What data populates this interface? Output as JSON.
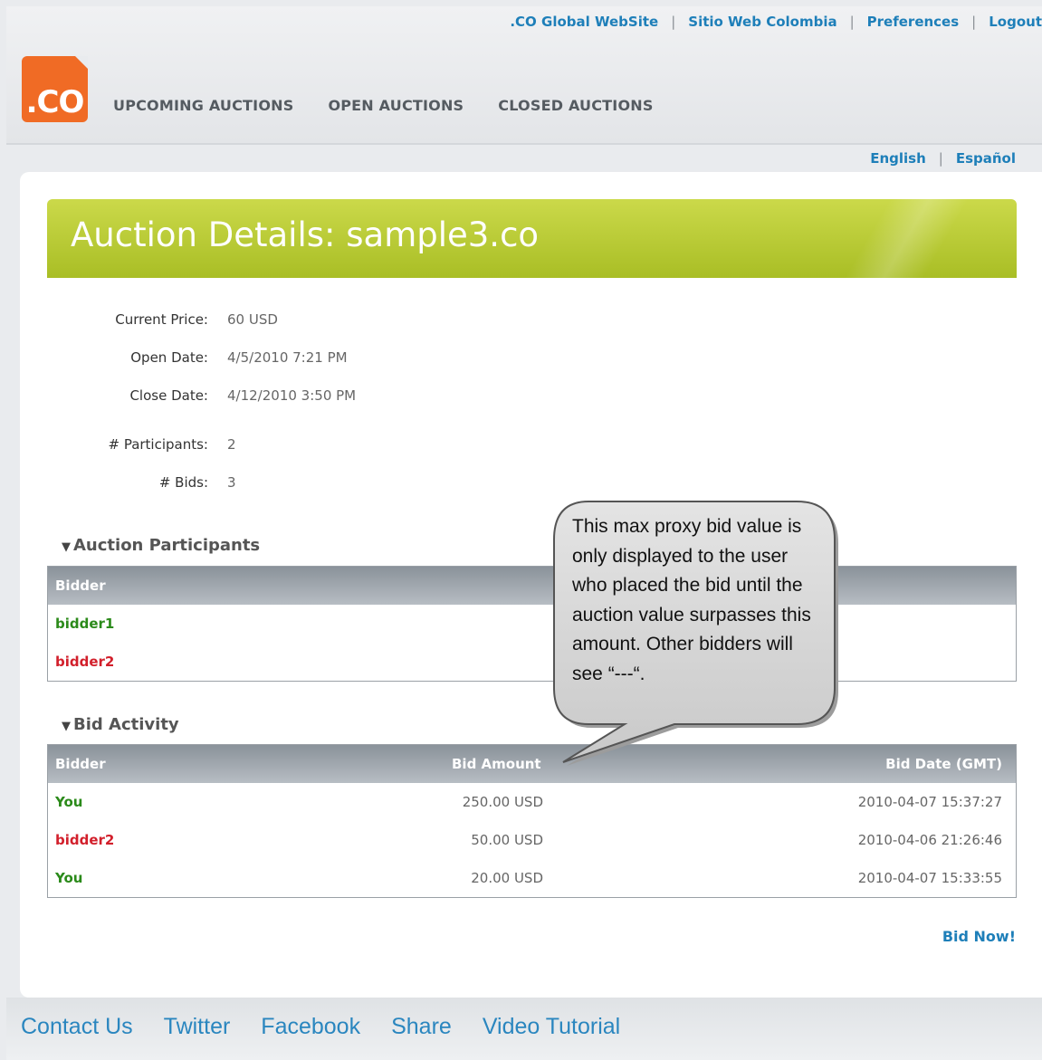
{
  "top_links": [
    ".CO Global WebSite",
    "Sitio Web Colombia",
    "Preferences",
    "Logout"
  ],
  "logo_text": ".CO",
  "main_nav": [
    "UPCOMING AUCTIONS",
    "OPEN AUCTIONS",
    "CLOSED AUCTIONS"
  ],
  "languages": [
    "English",
    "Español"
  ],
  "page_title": "Auction Details: sample3.co",
  "details": [
    {
      "label": "Current Price:",
      "value": "60 USD"
    },
    {
      "label": "Open Date:",
      "value": "4/5/2010 7:21 PM"
    },
    {
      "label": "Close Date:",
      "value": "4/12/2010 3:50 PM"
    },
    {
      "label": "# Participants:",
      "value": "2"
    },
    {
      "label": "# Bids:",
      "value": "3"
    }
  ],
  "participants_section": {
    "title": "Auction Participants",
    "header": "Bidder",
    "rows": [
      "bidder1",
      "bidder2"
    ]
  },
  "bids_section": {
    "title": "Bid Activity",
    "headers": [
      "Bidder",
      "Bid Amount",
      "Bid Date (GMT)"
    ],
    "rows": [
      {
        "bidder": "You",
        "amount": "250.00 USD",
        "date": "2010-04-07 15:37:27"
      },
      {
        "bidder": "bidder2",
        "amount": "50.00 USD",
        "date": "2010-04-06 21:26:46"
      },
      {
        "bidder": "You",
        "amount": "20.00 USD",
        "date": "2010-04-07 15:33:55"
      }
    ]
  },
  "bid_now": "Bid Now!",
  "callout_text": " This max proxy bid value is only displayed to the user who placed the bid until the auction value surpasses this amount. Other bidders will see “---“.",
  "footer_links": [
    "Contact Us",
    "Twitter",
    "Facebook",
    "Share",
    "Video Tutorial"
  ],
  "colors": {
    "accent_link": "#1e7fb9",
    "brand_orange": "#f06b25",
    "banner_green": "#b5c930",
    "bidder_green": "#2b8a1a",
    "bidder_red": "#d21f2b"
  }
}
